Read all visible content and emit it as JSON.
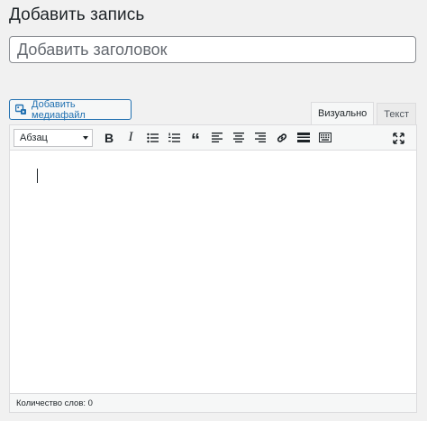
{
  "page": {
    "title": "Добавить запись"
  },
  "title_field": {
    "placeholder": "Добавить заголовок",
    "value": ""
  },
  "media": {
    "button_label": "Добавить медиафайл",
    "icon": "media-icon"
  },
  "editor_tabs": [
    {
      "label": "Визуально",
      "active": true
    },
    {
      "label": "Текст",
      "active": false
    }
  ],
  "toolbar": {
    "format_select": "Абзац",
    "buttons": [
      "bold",
      "italic",
      "bulleted-list",
      "numbered-list",
      "blockquote",
      "align-left",
      "align-center",
      "align-right",
      "insert-link",
      "read-more",
      "toolbar-toggle",
      "fullscreen"
    ],
    "bold_glyph": "B",
    "italic_glyph": "I",
    "quote_glyph": "“"
  },
  "status": {
    "word_count": "Количество слов: 0"
  }
}
